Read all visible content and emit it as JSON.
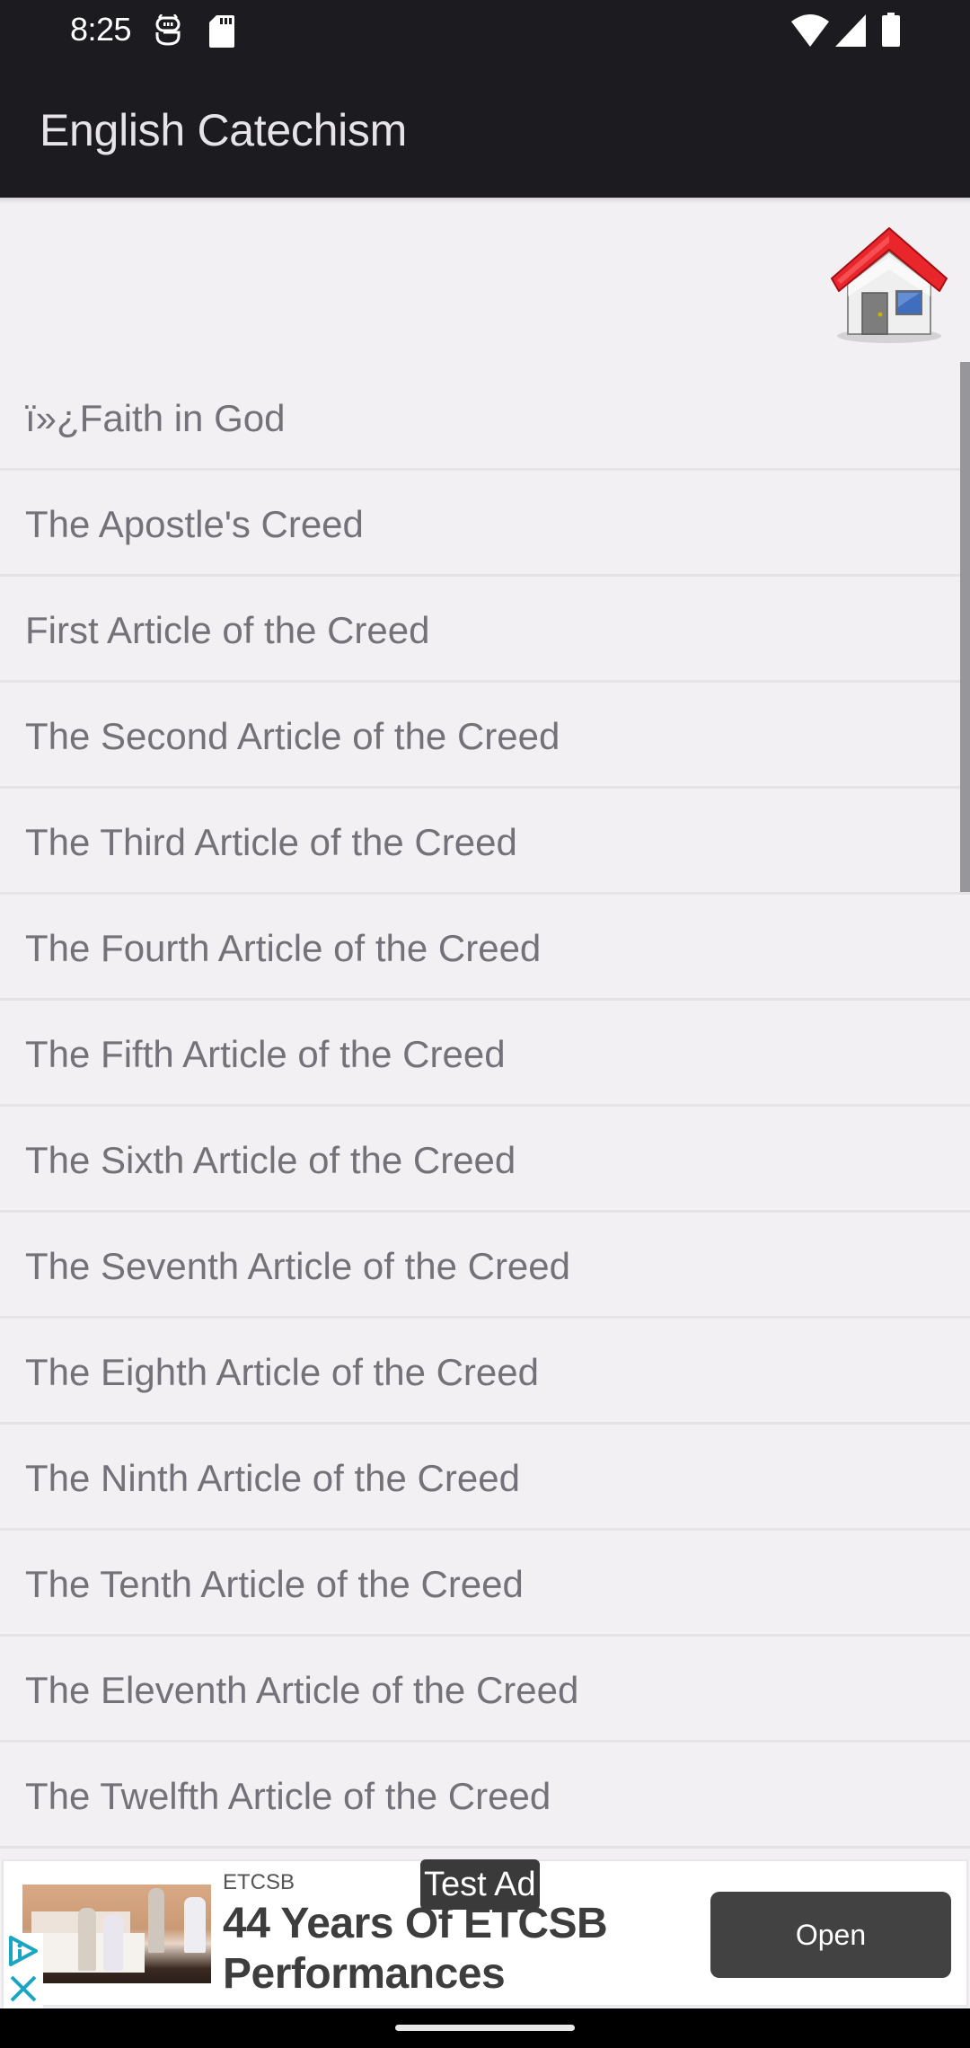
{
  "status_bar": {
    "time": "8:25",
    "left_icons": [
      "notification-app-icon",
      "sd-card-icon"
    ],
    "right_icons": [
      "wifi-icon",
      "cell-signal-icon",
      "battery-icon"
    ]
  },
  "toolbar": {
    "title": "English Catechism"
  },
  "home_button": {
    "icon": "home-icon"
  },
  "list": {
    "items": [
      {
        "label": "ï»¿Faith in God"
      },
      {
        "label": "The Apostle's Creed"
      },
      {
        "label": "First Article of the Creed"
      },
      {
        "label": "The Second Article of the Creed"
      },
      {
        "label": "The Third Article of the Creed"
      },
      {
        "label": "The Fourth Article of the Creed"
      },
      {
        "label": "The Fifth Article of the Creed"
      },
      {
        "label": "The Sixth Article of the Creed"
      },
      {
        "label": "The Seventh Article of the Creed"
      },
      {
        "label": "The Eighth Article of the Creed"
      },
      {
        "label": "The Ninth Article of the Creed"
      },
      {
        "label": "The Tenth Article of the Creed"
      },
      {
        "label": "The Eleventh Article of the Creed"
      },
      {
        "label": "The Twelfth Article of the Creed"
      }
    ]
  },
  "ad": {
    "badge": "Test Ad",
    "advertiser": "ETCSB",
    "headline": "44 Years Of ETCSB Performances",
    "cta": "Open",
    "accent_color": "#1aa6c2"
  }
}
